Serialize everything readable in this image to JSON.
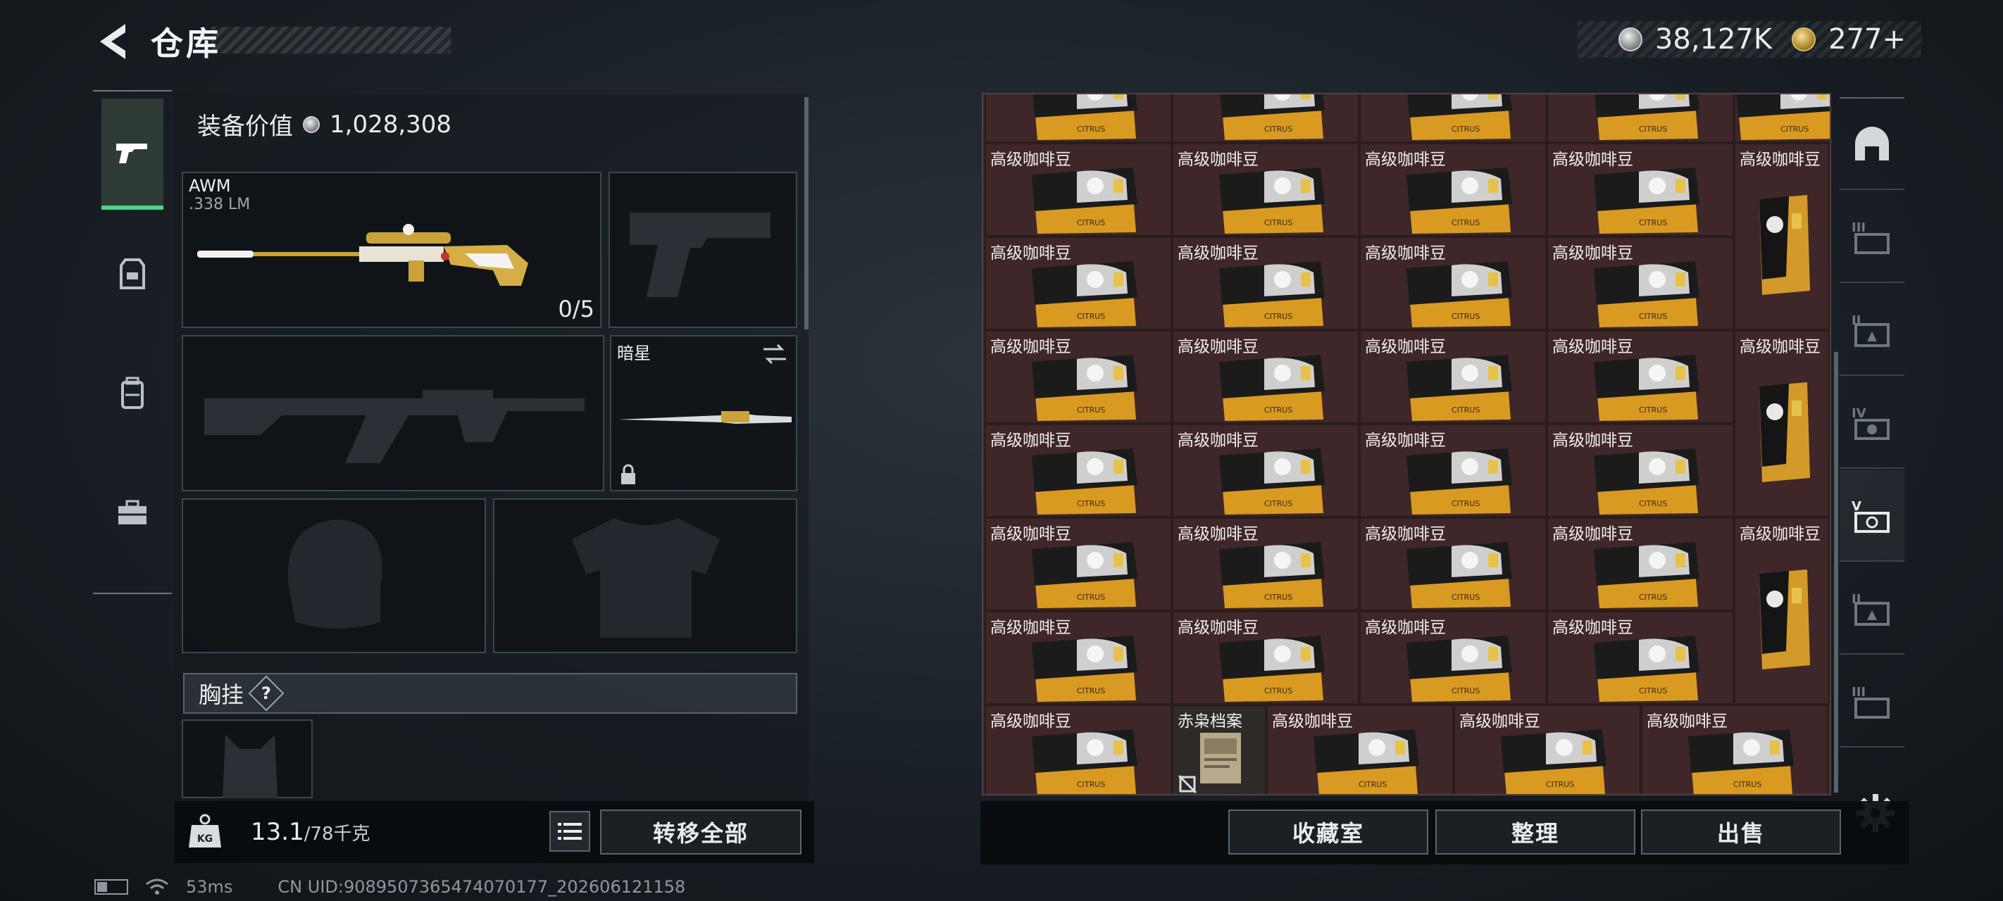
{
  "header": {
    "title": "仓库",
    "currencies": [
      {
        "icon": "silver-coin-icon",
        "value": "38,127K"
      },
      {
        "icon": "gold-coin-icon",
        "value": "277+"
      }
    ]
  },
  "equipment": {
    "value_label": "装备价值",
    "value": "1,028,308",
    "primary_weapon": {
      "name": "AWM",
      "ammo": ".338 LM",
      "attachments": "0/5"
    },
    "melee": {
      "name": "暗星"
    },
    "chest_rig_label": "胸挂",
    "chest_rig_help": "?"
  },
  "weight": {
    "current": "13.1",
    "max": "/78千克"
  },
  "buttons": {
    "transfer_all": "转移全部",
    "collection": "收藏室",
    "organize": "整理",
    "sell": "出售"
  },
  "storage": {
    "item_name": "高级咖啡豆",
    "special_item": "赤枭档案"
  },
  "status": {
    "ping": "53ms",
    "uid": "CN UID:9089507365474070177_202606121158"
  },
  "colors": {
    "accent_green": "#47d68a",
    "storage_bg": "#3a2526"
  }
}
